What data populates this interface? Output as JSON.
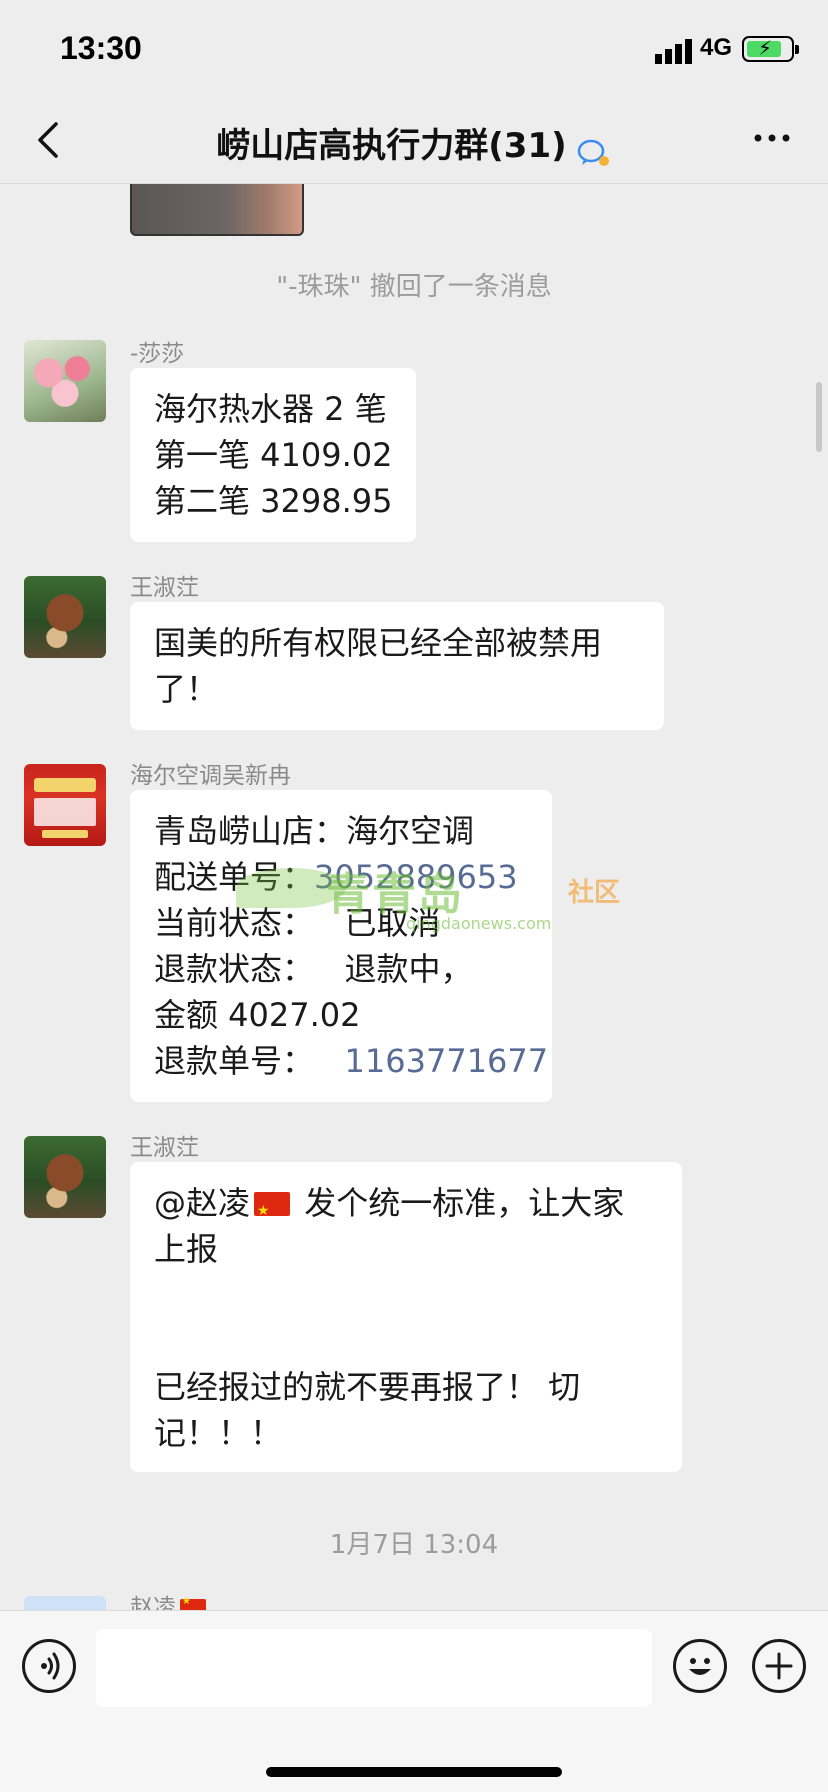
{
  "status_bar": {
    "time": "13:30",
    "network": "4G"
  },
  "nav": {
    "title": "崂山店高执行力群(31)"
  },
  "messages": {
    "recall_note": "\"-珠珠\" 撤回了一条消息",
    "m1": {
      "sender": "-莎莎",
      "lines": [
        "海尔热水器 2 笔",
        "第一笔 4109.02",
        "第二笔 3298.95"
      ]
    },
    "m2": {
      "sender": "王淑茳",
      "lines": [
        "国美的所有权限已经全部被禁用",
        "了！"
      ]
    },
    "m3": {
      "sender": "海尔空调吴新冉",
      "line1": "青岛崂山店：海尔空调",
      "line2_prefix": "配送单号：",
      "line2_link": "3052889653",
      "line3": "当前状态：   已取消",
      "line4": "退款状态：   退款中，",
      "line5": "金额 4027.02",
      "line6_prefix": "退款单号：   ",
      "line6_link": "1163771677"
    },
    "m4": {
      "sender": "王淑茳",
      "mention": "@赵凌",
      "line1_rest": " 发个统一标准，让大家",
      "line2": "上报",
      "line3": "已经报过的就不要再报了！ 切",
      "line4": "记！！！"
    },
    "timestamp": "1月7日 13:04",
    "m5": {
      "sender": "赵凌"
    }
  },
  "watermark": {
    "brand": "青青岛",
    "community": "社区",
    "url": "qingdaonews.com"
  },
  "input": {
    "placeholder": ""
  },
  "colors": {
    "background": "#ededed",
    "bubble": "#ffffff",
    "link": "#586b94"
  },
  "icons": {
    "back": "chevron-left-icon",
    "chat": "chat-bubble-icon",
    "more": "more-dots-icon",
    "voice": "voice-icon",
    "emoji": "emoji-icon",
    "plus": "plus-icon"
  }
}
